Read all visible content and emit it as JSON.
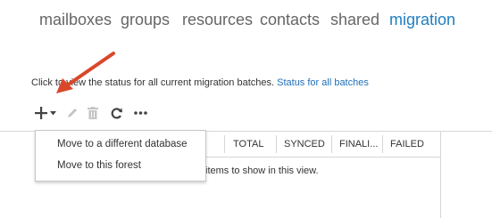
{
  "nav": {
    "tabs": [
      {
        "label": "mailboxes",
        "active": false
      },
      {
        "label": "groups",
        "active": false
      },
      {
        "label": "resources",
        "active": false
      },
      {
        "label": "contacts",
        "active": false
      },
      {
        "label": "shared",
        "active": false
      },
      {
        "label": "migration",
        "active": true
      }
    ]
  },
  "status": {
    "text": "Click to view the status for all current migration batches.",
    "link": "Status for all batches"
  },
  "toolbar": {
    "icons": [
      "add-icon",
      "dropdown-caret-icon",
      "edit-icon",
      "delete-icon",
      "refresh-icon",
      "more-icon"
    ]
  },
  "grid": {
    "columns": [
      "TOTAL",
      "SYNCED",
      "FINALI...",
      "FAILED"
    ],
    "empty_message": "items to show in this view."
  },
  "menu": {
    "items": [
      "Move to a different database",
      "Move to this forest"
    ]
  },
  "colors": {
    "accent": "#1f7ec1",
    "annotation_arrow": "#d9472b"
  }
}
